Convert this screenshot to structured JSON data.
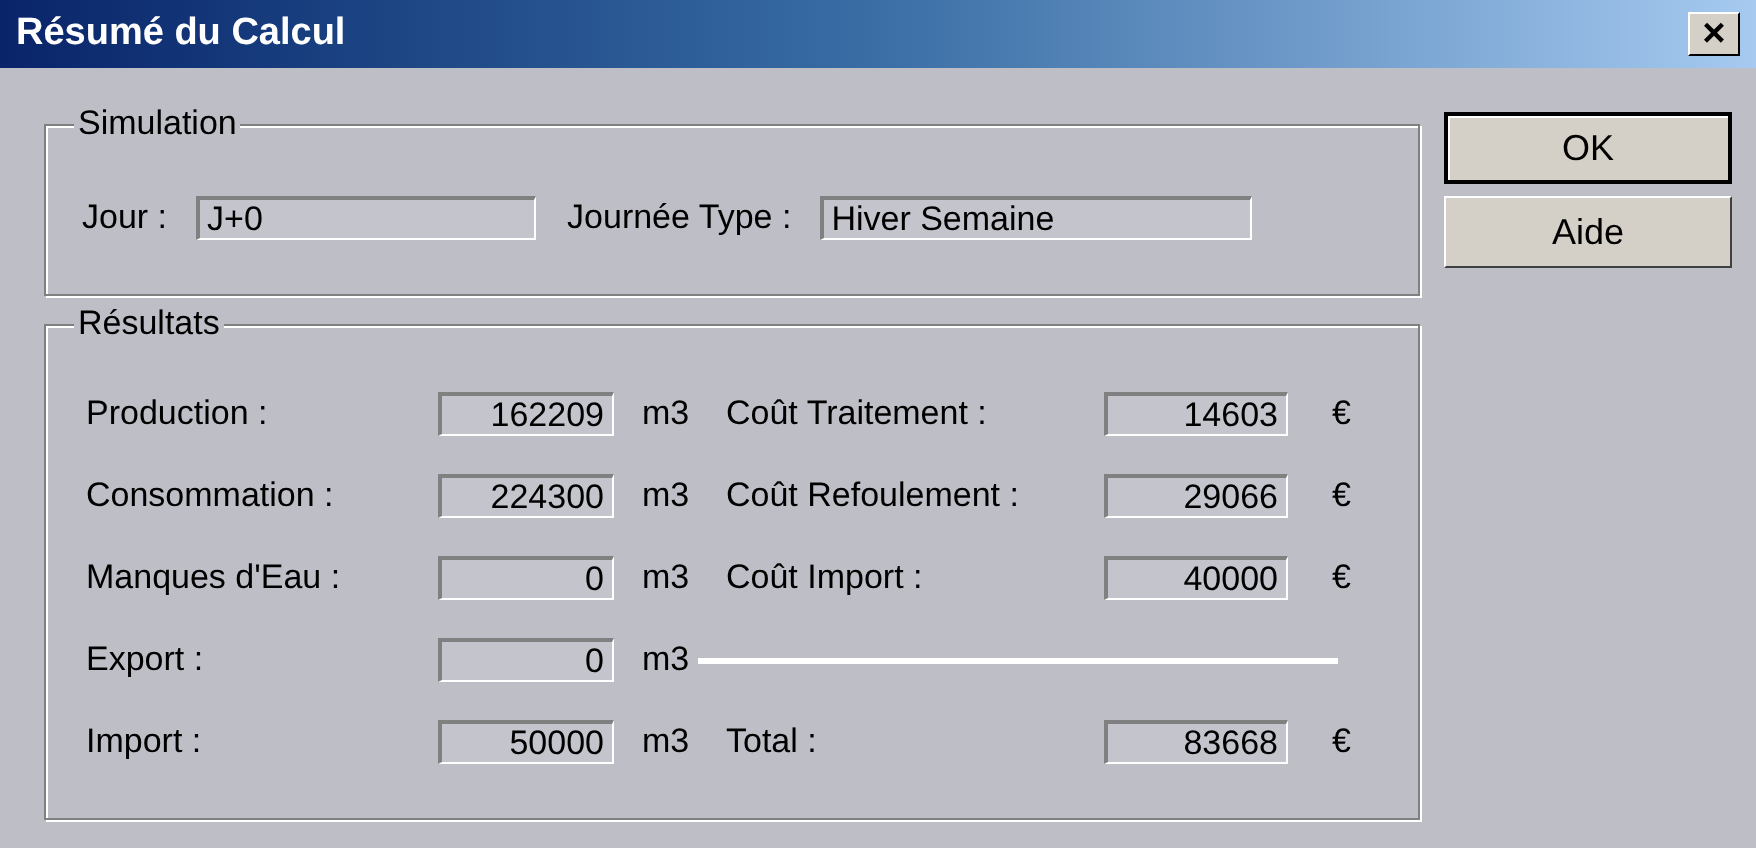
{
  "window": {
    "title": "Résumé du Calcul",
    "close": "×"
  },
  "simulation": {
    "title": "Simulation",
    "fields": [
      {
        "label": "Jour :",
        "value": "J+0"
      },
      {
        "label": "Journée Type :",
        "value": "Hiver Semaine"
      }
    ]
  },
  "results": {
    "title": "Résultats",
    "rows": [
      {
        "left": {
          "label": "Production :",
          "value": "162209",
          "unit": "m3"
        },
        "right": {
          "kind": "cost",
          "label": "Coût Traitement  :",
          "value": "14603",
          "unit": "€"
        }
      },
      {
        "left": {
          "label": "Consommation :",
          "value": "224300",
          "unit": "m3"
        },
        "right": {
          "kind": "cost",
          "label": "Coût Refoulement :",
          "value": "29066",
          "unit": "€"
        }
      },
      {
        "left": {
          "label": "Manques d'Eau :",
          "value": "0",
          "unit": "m3"
        },
        "right": {
          "kind": "cost",
          "label": "Coût Import :",
          "value": "40000",
          "unit": "€"
        }
      },
      {
        "left": {
          "label": "Export :",
          "value": "0",
          "unit": "m3"
        },
        "right": {
          "kind": "separator"
        }
      },
      {
        "left": {
          "label": "Import :",
          "value": "50000",
          "unit": "m3"
        },
        "right": {
          "kind": "cost",
          "label": "Total :",
          "value": "83668",
          "unit": "€"
        }
      }
    ]
  },
  "buttons": [
    {
      "label": "OK",
      "default": true
    },
    {
      "label": "Aide",
      "default": false
    }
  ]
}
